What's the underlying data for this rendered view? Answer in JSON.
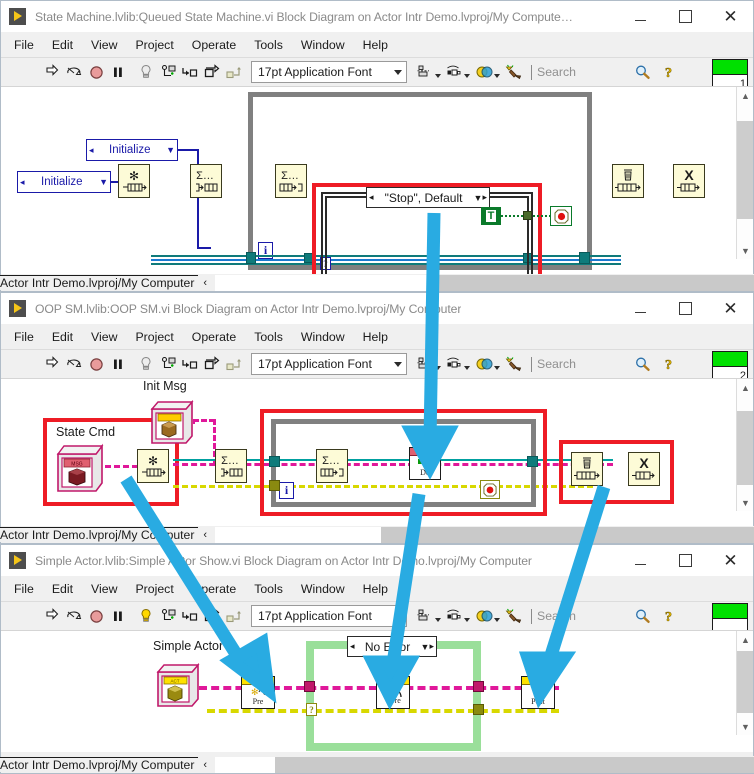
{
  "windows": [
    {
      "id": "win-queued-state-machine",
      "title": "State Machine.lvlib:Queued State Machine.vi Block Diagram on Actor Intr Demo.lvproj/My Compute…",
      "menu": [
        "File",
        "Edit",
        "View",
        "Project",
        "Operate",
        "Tools",
        "Window",
        "Help"
      ],
      "toolbar": {
        "font_label": "17pt Application Font",
        "search_placeholder": "Search",
        "icons": [
          "run-arrow-icon",
          "run-continuously-icon",
          "abort-stop-icon",
          "pause-icon",
          "highlight-execution-icon",
          "retain-wire-values-icon",
          "step-into-icon",
          "step-over-icon",
          "step-out-icon"
        ],
        "right_icons": [
          "align-objects-icon",
          "distribute-objects-icon",
          "reorder-icon",
          "clean-up-diagram-icon",
          "search-magnifier-icon",
          "help-question-icon"
        ]
      },
      "run_indicator": "1",
      "statusbar": {
        "text": "Actor Intr Demo.lvproj/My Computer",
        "chevron": "‹"
      },
      "diagram": {
        "enums": [
          {
            "name": "enum-initialize-left",
            "text": "Initialize"
          },
          {
            "name": "enum-initialize-top",
            "text": "Initialize"
          }
        ],
        "case_selector": "\"Stop\", Default",
        "nodes": [
          {
            "name": "obtain-queue-node",
            "glyph": "✻",
            "sub": "queue"
          },
          {
            "name": "enqueue-element-node",
            "glyph": "Σ…",
            "sub": "enqueue"
          },
          {
            "name": "dequeue-element-node",
            "glyph": "Σ…",
            "sub": "dequeue"
          },
          {
            "name": "release-queue-node",
            "glyph": "🗑",
            "sub": "release"
          },
          {
            "name": "destroy-queue-node",
            "glyph": "X",
            "sub": "destroy"
          }
        ],
        "loop_tag": "i",
        "boolean_constant": "T",
        "stop_terminal": "stop-button-terminal"
      }
    },
    {
      "id": "win-oop-sm",
      "title": "OOP SM.lvlib:OOP SM.vi Block Diagram on Actor Intr Demo.lvproj/My Computer",
      "menu": [
        "File",
        "Edit",
        "View",
        "Project",
        "Operate",
        "Tools",
        "Window",
        "Help"
      ],
      "toolbar": {
        "font_label": "17pt Application Font",
        "search_placeholder": "Search"
      },
      "run_indicator": "2",
      "statusbar": {
        "text": "Actor Intr Demo.lvproj/My Computer",
        "chevron": "‹"
      },
      "diagram": {
        "labels": [
          {
            "name": "label-init-msg",
            "text": "Init Msg"
          },
          {
            "name": "label-state-cmd",
            "text": "State Cmd"
          }
        ],
        "class_constants": [
          {
            "name": "init-msg-class-constant",
            "banner": "",
            "banner_color": "#ffcc00"
          },
          {
            "name": "state-cmd-class-constant",
            "banner": "MSG",
            "banner_color": "#e06070"
          }
        ],
        "nodes": [
          {
            "name": "obtain-queue-node",
            "glyph": "✻"
          },
          {
            "name": "enqueue-element-node",
            "glyph": "Σ…"
          },
          {
            "name": "dequeue-element-node",
            "glyph": "Σ…"
          },
          {
            "name": "do-method-node",
            "glyph": "Do",
            "banner": "MSG"
          },
          {
            "name": "release-queue-node",
            "glyph": "🗑"
          },
          {
            "name": "destroy-queue-node",
            "glyph": "X"
          }
        ],
        "loop_tag": "i",
        "stop_terminal": "stop-button-terminal"
      }
    },
    {
      "id": "win-simple-actor",
      "title": "Simple Actor.lvlib:Simple Actor Show.vi Block Diagram on Actor Intr Demo.lvproj/My Computer",
      "menu": [
        "File",
        "Edit",
        "View",
        "Project",
        "Operate",
        "Tools",
        "Window",
        "Help"
      ],
      "toolbar": {
        "font_label": "17pt Application Font",
        "search_placeholder": "Search"
      },
      "run_indicator": "",
      "statusbar": {
        "text": "Actor Intr Demo.lvproj/My Computer",
        "chevron": "‹"
      },
      "diagram": {
        "labels": [
          {
            "name": "label-simple-actor",
            "text": "Simple Actor"
          }
        ],
        "case_selector": "No Error",
        "class_constants": [
          {
            "name": "simple-actor-class-constant",
            "banner": "ACT",
            "banner_color": "#ffe100"
          }
        ],
        "nodes": [
          {
            "name": "pre-method-node",
            "banner": "ACT",
            "caption": "Pre"
          },
          {
            "name": "core-method-node",
            "banner": "ACT",
            "caption": "Core"
          },
          {
            "name": "post-method-node",
            "banner": "ACT",
            "caption": "Post"
          }
        ]
      }
    }
  ],
  "annotations": {
    "arrow_color": "#29abe2",
    "highlight_color": "#ee1c25",
    "arrows": [
      {
        "name": "annotation-arrow-1",
        "from": "queued-sm-case-structure",
        "to": "oop-sm-do-method"
      },
      {
        "name": "annotation-arrow-2",
        "from": "oop-sm-state-cmd-group",
        "to": "simple-actor-pre-method"
      },
      {
        "name": "annotation-arrow-3",
        "from": "oop-sm-loop-body",
        "to": "simple-actor-core-method"
      },
      {
        "name": "annotation-arrow-4",
        "from": "oop-sm-release-group",
        "to": "simple-actor-post-method"
      }
    ]
  }
}
